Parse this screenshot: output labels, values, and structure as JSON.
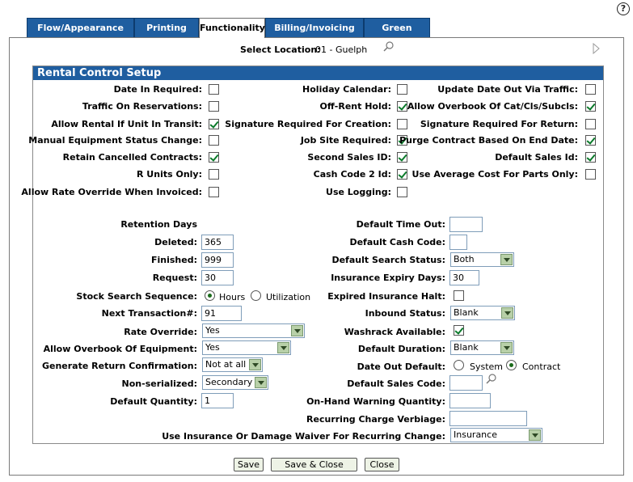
{
  "tabs": [
    "Flow/Appearance",
    "Printing",
    "Functionality",
    "Billing/Invoicing",
    "Green Screen"
  ],
  "location": {
    "label": "Select Location:",
    "value": "01 - Guelph"
  },
  "section_title": "Rental Control Setup",
  "checkboxes": {
    "date_in_required": "Date In Required:",
    "holiday_calendar": "Holiday Calendar:",
    "update_date_out": "Update Date Out Via Traffic:",
    "traffic_on_res": "Traffic On Reservations:",
    "off_rent_hold": "Off-Rent Hold:",
    "allow_overbook_cat": "Allow Overbook Of Cat/Cls/Subcls:",
    "allow_rental_transit": "Allow Rental If Unit In Transit:",
    "sig_req_creation": "Signature Required For Creation:",
    "sig_req_return": "Signature Required For Return:",
    "manual_equip_status": "Manual Equipment Status Change:",
    "job_site_required": "Job Site Required:",
    "purge_contract": "Purge Contract Based On End Date:",
    "retain_cancelled": "Retain Cancelled Contracts:",
    "second_sales_id": "Second Sales ID:",
    "default_sales_id": "Default Sales Id:",
    "r_units_only": "R Units Only:",
    "cash_code_2": "Cash Code 2 Id:",
    "use_avg_cost": "Use Average Cost For Parts Only:",
    "allow_rate_override": "Allow Rate Override When Invoiced:",
    "use_logging": "Use Logging:"
  },
  "retention": {
    "heading": "Retention Days",
    "deleted_label": "Deleted:",
    "deleted": "365",
    "finished_label": "Finished:",
    "finished": "999",
    "request_label": "Request:",
    "request": "30"
  },
  "left_fields": {
    "stock_search_label": "Stock Search Sequence:",
    "stock_opt1": "Hours",
    "stock_opt2": "Utilization",
    "next_trans_label": "Next Transaction#:",
    "next_trans": "91",
    "rate_override_label": "Rate Override:",
    "rate_override": "Yes",
    "allow_overbook_equip_label": "Allow Overbook Of Equipment:",
    "allow_overbook_equip": "Yes",
    "gen_return_label": "Generate Return Confirmation:",
    "gen_return": "Not at all",
    "non_serialized_label": "Non-serialized:",
    "non_serialized": "Secondary",
    "default_qty_label": "Default Quantity:",
    "default_qty": "1"
  },
  "right_fields": {
    "default_timeout_label": "Default Time Out:",
    "default_timeout": "",
    "default_cash_label": "Default Cash Code:",
    "default_cash": "",
    "default_search_label": "Default Search Status:",
    "default_search": "Both",
    "ins_expiry_label": "Insurance Expiry Days:",
    "ins_expiry": "30",
    "expired_ins_label": "Expired Insurance Halt:",
    "inbound_label": "Inbound Status:",
    "inbound": "Blank",
    "washrack_label": "Washrack Available:",
    "default_duration_label": "Default Duration:",
    "default_duration": "Blank",
    "date_out_label": "Date Out Default:",
    "date_out_opt1": "System",
    "date_out_opt2": "Contract",
    "default_sales_code_label": "Default Sales Code:",
    "default_sales_code": "",
    "onhand_label": "On-Hand Warning Quantity:",
    "onhand": "",
    "recurring_label": "Recurring Charge Verbiage:",
    "recurring": "",
    "insurance_waiver_label": "Use Insurance Or Damage Waiver For Recurring Change:",
    "insurance_waiver": "Insurance"
  },
  "buttons": {
    "save": "Save",
    "save_close": "Save & Close",
    "close": "Close"
  },
  "help": "?"
}
